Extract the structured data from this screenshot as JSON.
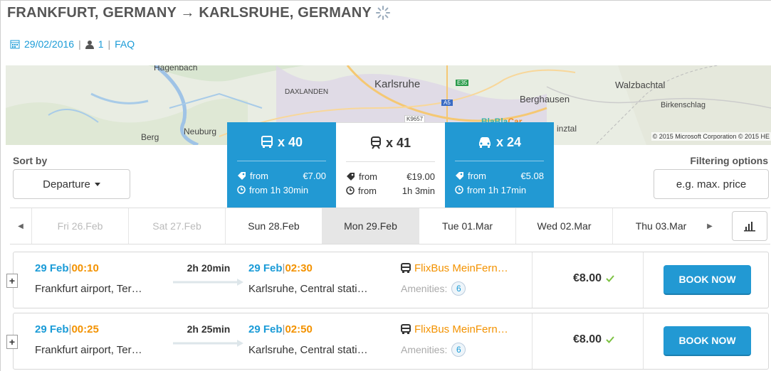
{
  "header": {
    "title": "FRANKFURT, GERMANY → KARLSRUHE, GERMANY",
    "date": "29/02/2016",
    "passengers": "1",
    "faq": "FAQ",
    "separator": "|"
  },
  "map": {
    "labels": {
      "hagenbach": "Hagenbach",
      "daxlanden": "DAXLANDEN",
      "karlsruhe": "Karlsruhe",
      "berghausen": "Berghausen",
      "walzbachtal": "Walzbachtal",
      "birkenschlag": "Birkenschlag",
      "berg": "Berg",
      "neuburg": "Neuburg",
      "inztal": "inztal",
      "e35": "E35",
      "a5": "A5",
      "k9657": "K9657"
    },
    "copyright": "© 2015 Microsoft Corporation © 2015 HE",
    "blablacar_a": "BlaBla",
    "blablacar_b": "Car"
  },
  "sort": {
    "label": "Sort by",
    "value": "Departure"
  },
  "filter": {
    "label": "Filtering options",
    "placeholder": "e.g. max. price"
  },
  "modes": [
    {
      "icon": "bus-icon",
      "count": "x 40",
      "from_label": "from",
      "price": "€7.00",
      "duration": "from 1h 30min",
      "active": true
    },
    {
      "icon": "train-icon",
      "count": "x 41",
      "from_label": "from",
      "price": "€19.00",
      "duration_label": "from",
      "duration": "1h 3min",
      "active": false
    },
    {
      "icon": "car-icon",
      "count": "x 24",
      "from_label": "from",
      "price": "€5.08",
      "duration": "from 1h 17min",
      "active": true
    }
  ],
  "dates": [
    {
      "label": "Fri 26.Feb",
      "state": "past"
    },
    {
      "label": "Sat 27.Feb",
      "state": "past"
    },
    {
      "label": "Sun 28.Feb",
      "state": "normal"
    },
    {
      "label": "Mon 29.Feb",
      "state": "active"
    },
    {
      "label": "Tue 01.Mar",
      "state": "normal"
    },
    {
      "label": "Wed 02.Mar",
      "state": "normal"
    },
    {
      "label": "Thu 03.Mar",
      "state": "normal"
    }
  ],
  "results": [
    {
      "dep_date": "29 Feb",
      "dep_time": "00:10",
      "dep_place": "Frankfurt airport, Ter…",
      "duration": "2h 20min",
      "arr_date": "29 Feb",
      "arr_time": "02:30",
      "arr_place": "Karlsruhe, Central stati…",
      "operator": "FlixBus MeinFern…",
      "amenities_label": "Amenities:",
      "amenities": "6",
      "price": "€8.00",
      "book": "BOOK NOW",
      "expand": "+"
    },
    {
      "dep_date": "29 Feb",
      "dep_time": "00:25",
      "dep_place": "Frankfurt airport, Ter…",
      "duration": "2h 25min",
      "arr_date": "29 Feb",
      "arr_time": "02:50",
      "arr_place": "Karlsruhe, Central stati…",
      "operator": "FlixBus MeinFern…",
      "amenities_label": "Amenities:",
      "amenities": "6",
      "price": "€8.00",
      "book": "BOOK NOW",
      "expand": "+"
    }
  ],
  "colors": {
    "accent": "#2299d3",
    "orange": "#f39200",
    "link": "#1a9bd7",
    "check": "#7cc242"
  }
}
